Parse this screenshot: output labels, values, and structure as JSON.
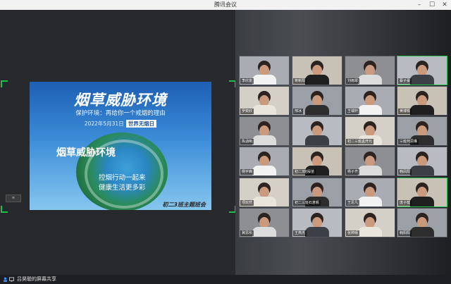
{
  "window": {
    "title": "腾讯会议"
  },
  "slide": {
    "title": "烟草威胁环境",
    "subtitle": "保护环境：再给你一个戒烟的理由",
    "date": "2022年5月31日",
    "date_tag": "世界无烟日",
    "ban_title": "烟草威胁环境",
    "line1": "控烟行动一起来",
    "line2": "健康生活更多彩",
    "footer": "初二3班主题班会"
  },
  "participants": [
    {
      "name": "李欣富"
    },
    {
      "name": "蒋新阳"
    },
    {
      "name": "刘雨翠"
    },
    {
      "name": "蔡子豪"
    },
    {
      "name": "罗奕欣"
    },
    {
      "name": "邢冰"
    },
    {
      "name": "王瑞轩"
    },
    {
      "name": "黄博轶"
    },
    {
      "name": "陈涵晰"
    },
    {
      "name": ""
    },
    {
      "name": "初二三班孟开元"
    },
    {
      "name": "三班何思琳"
    },
    {
      "name": "杨宇峰"
    },
    {
      "name": "初二3班殷苗"
    },
    {
      "name": "杨子齐"
    },
    {
      "name": "韩凤阳"
    },
    {
      "name": "项欢然"
    },
    {
      "name": "初二三班石意帆"
    },
    {
      "name": "王思凡"
    },
    {
      "name": "庞子健"
    },
    {
      "name": "冀思彤"
    },
    {
      "name": "王燕杰"
    },
    {
      "name": "张婷晴"
    },
    {
      "name": "韩阳阳"
    }
  ],
  "status": {
    "share_text": "吕昊聪的屏幕共享"
  },
  "colors": {
    "accent": "#25c24f",
    "slide_blue": "#1d5fb3"
  },
  "icons": {
    "close": "close-icon",
    "minimize": "minimize-icon",
    "maximize": "maximize-icon",
    "user": "user-icon",
    "screen": "screen-share-icon"
  }
}
